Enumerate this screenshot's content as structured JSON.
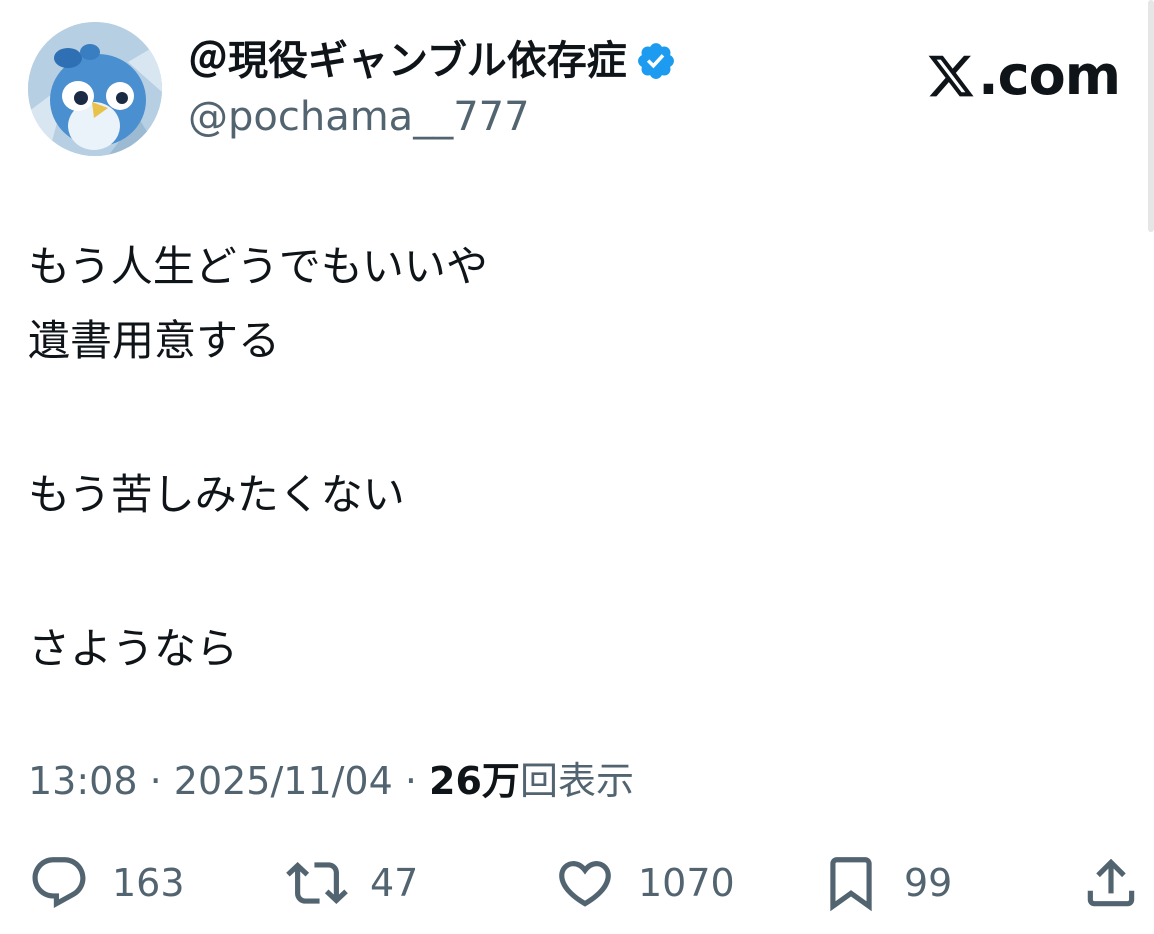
{
  "user": {
    "display_name": "＠現役ギャンブル依存症",
    "handle": "@pochama__777",
    "verified": true,
    "avatar_icon": "penguin-avatar"
  },
  "brand": {
    "logo_icon": "x-logo-icon",
    "domain_suffix": ".com"
  },
  "tweet": {
    "lines": [
      "もう人生どうでもいいや",
      "遺書用意する",
      "",
      "もう苦しみたくない",
      "",
      "さようなら"
    ]
  },
  "meta": {
    "time": "13:08",
    "date": "2025/11/04",
    "views_count": "26万",
    "views_label": "回表示",
    "separator": " · "
  },
  "actions": {
    "reply": {
      "icon": "reply-icon",
      "count": "163"
    },
    "retweet": {
      "icon": "retweet-icon",
      "count": "47"
    },
    "like": {
      "icon": "heart-icon",
      "count": "1070"
    },
    "bookmark": {
      "icon": "bookmark-icon",
      "count": "99"
    },
    "share": {
      "icon": "share-icon"
    }
  },
  "colors": {
    "text_primary": "#0f1419",
    "text_secondary": "#536471",
    "verified_blue": "#1d9bf0"
  }
}
